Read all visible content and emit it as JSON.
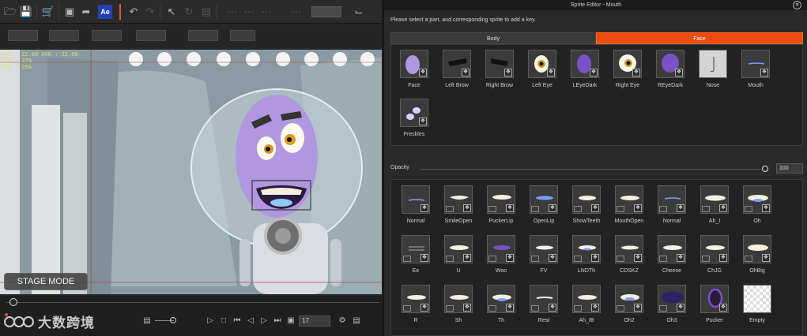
{
  "left_app": {
    "stage_mode_label": "STAGE MODE",
    "fps_lines": [
      "FPS : 22.09  AVG : 22.09",
      "RAM : 37%",
      "CPU : 25%"
    ],
    "frame_value": "17",
    "brand_text": "大数跨境"
  },
  "sprite_editor": {
    "title": "Sprite Editor - Mouth",
    "close_icon": "close-icon",
    "instruction": "Please select a part, and corresponding sprite to add a key.",
    "tabs": [
      {
        "label": "Body",
        "active": false
      },
      {
        "label": "Face",
        "active": true
      }
    ],
    "accent_color": "#ec4d0e",
    "parts": [
      "Face",
      "Left Brow",
      "Right Brow",
      "Left Eye",
      "LEyeDark",
      "Right Eye",
      "REyeDark",
      "Nose",
      "Mouth",
      "Freckles"
    ],
    "opacity_label": "Opacity",
    "opacity_value": "100",
    "sprites": [
      "Normal",
      "SmileOpen",
      "PuckerLip",
      "OpenLip",
      "ShowTeeth",
      "MouthOpen",
      "Normal",
      "Ah_I",
      "Oh",
      "Ee",
      "U",
      "Woo",
      "FV",
      "LNDTh",
      "CDSKZ",
      "Cheese",
      "ChJG",
      "OhBig",
      "R",
      "Sh",
      "Th",
      "Rest",
      "Ah_IB",
      "Oh2",
      "Oh3",
      "Pucker",
      "Empty"
    ]
  }
}
